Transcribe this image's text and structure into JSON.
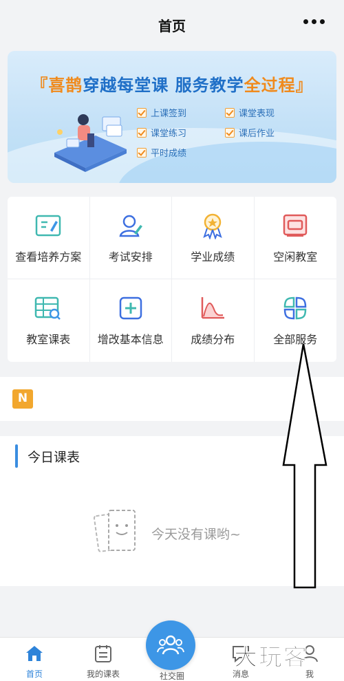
{
  "nav": {
    "title": "首页"
  },
  "banner": {
    "bracket_left": "『",
    "brand": "喜鹊",
    "headline_mid": "穿越每堂课 服务教学",
    "headline_accent": "全过程",
    "bracket_right": "』",
    "features": [
      "上课签到",
      "课堂表现",
      "课堂练习",
      "课后作业",
      "平时成绩"
    ]
  },
  "services": [
    {
      "label": "查看培养方案",
      "icon": "training-plan-icon"
    },
    {
      "label": "考试安排",
      "icon": "exam-schedule-icon"
    },
    {
      "label": "学业成绩",
      "icon": "grades-icon"
    },
    {
      "label": "空闲教室",
      "icon": "empty-classroom-icon"
    },
    {
      "label": "教室课表",
      "icon": "classroom-timetable-icon"
    },
    {
      "label": "增改基本信息",
      "icon": "edit-info-icon"
    },
    {
      "label": "成绩分布",
      "icon": "score-distribution-icon"
    },
    {
      "label": "全部服务",
      "icon": "all-services-icon"
    }
  ],
  "notice": {
    "icon_letter": "N"
  },
  "today": {
    "title": "今日课表",
    "empty_text": "今天没有课哟~"
  },
  "tabbar": {
    "home": "首页",
    "my_schedule": "我的课表",
    "social": "社交圈",
    "messages": "消息",
    "me": "我"
  },
  "watermark": "大玩客",
  "colors": {
    "accent": "#3d96e6",
    "orange": "#f08a1c",
    "red_icon": "#e05a5a",
    "teal_icon": "#3fb8b0"
  }
}
